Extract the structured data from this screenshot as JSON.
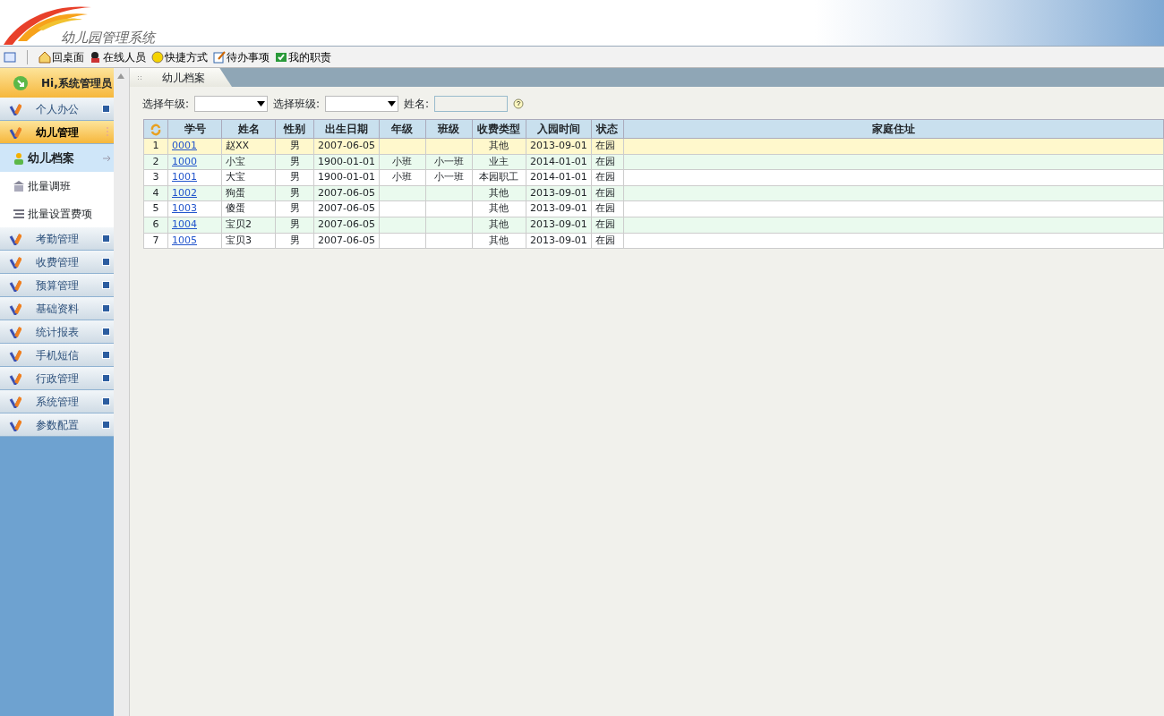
{
  "app": {
    "title": "幼儿园管理系统"
  },
  "toolbar": [
    {
      "label": "回桌面",
      "kind": "home"
    },
    {
      "label": "在线人员",
      "kind": "people"
    },
    {
      "label": "快捷方式",
      "kind": "smile"
    },
    {
      "label": "待办事项",
      "kind": "note"
    },
    {
      "label": "我的职责",
      "kind": "check"
    }
  ],
  "sidebar": {
    "user": "Hi,系统管理员",
    "groups": [
      {
        "label": "个人办公",
        "selected": false,
        "expanded": false
      },
      {
        "label": "幼儿管理",
        "selected": true,
        "expanded": true,
        "children": [
          {
            "label": "幼儿档案",
            "selected": true,
            "kind": "person"
          },
          {
            "label": "批量调班",
            "selected": false,
            "kind": "bank"
          },
          {
            "label": "批量设置费项",
            "selected": false,
            "kind": "list"
          }
        ]
      },
      {
        "label": "考勤管理",
        "selected": false,
        "expanded": false
      },
      {
        "label": "收费管理",
        "selected": false,
        "expanded": false
      },
      {
        "label": "预算管理",
        "selected": false,
        "expanded": false
      },
      {
        "label": "基础资料",
        "selected": false,
        "expanded": false
      },
      {
        "label": "统计报表",
        "selected": false,
        "expanded": false
      },
      {
        "label": "手机短信",
        "selected": false,
        "expanded": false
      },
      {
        "label": "行政管理",
        "selected": false,
        "expanded": false
      },
      {
        "label": "系统管理",
        "selected": false,
        "expanded": false
      },
      {
        "label": "参数配置",
        "selected": false,
        "expanded": false
      }
    ]
  },
  "tabs": [
    {
      "label": "幼儿档案",
      "selected": true
    }
  ],
  "filters": [
    {
      "label": "选择年级:",
      "kind": "select"
    },
    {
      "label": "选择班级:",
      "kind": "select"
    },
    {
      "label": "姓名:",
      "kind": "text"
    }
  ],
  "table": {
    "columns": [
      "学号",
      "姓名",
      "性别",
      "出生日期",
      "年级",
      "班级",
      "收费类型",
      "入园时间",
      "状态",
      "家庭住址"
    ],
    "rows": [
      {
        "selected": true,
        "number": "1",
        "cells": [
          "0001",
          "赵XX",
          "男",
          "2007-06-05",
          "",
          "",
          "其他",
          "2013-09-01",
          "在园"
        ]
      },
      {
        "selected": false,
        "number": "2",
        "cells": [
          "1000",
          "小宝",
          "男",
          "1900-01-01",
          "小班",
          "小一班",
          "业主",
          "2014-01-01",
          "在园"
        ]
      },
      {
        "selected": false,
        "number": "3",
        "cells": [
          "1001",
          "大宝",
          "男",
          "1900-01-01",
          "小班",
          "小一班",
          "本园职工",
          "2014-01-01",
          "在园"
        ]
      },
      {
        "selected": false,
        "number": "4",
        "cells": [
          "1002",
          "狗蛋",
          "男",
          "2007-06-05",
          "",
          "",
          "其他",
          "2013-09-01",
          "在园"
        ]
      },
      {
        "selected": false,
        "number": "5",
        "cells": [
          "1003",
          "傻蛋",
          "男",
          "2007-06-05",
          "",
          "",
          "其他",
          "2013-09-01",
          "在园"
        ]
      },
      {
        "selected": false,
        "number": "6",
        "cells": [
          "1004",
          "宝贝2",
          "男",
          "2007-06-05",
          "",
          "",
          "其他",
          "2013-09-01",
          "在园"
        ]
      },
      {
        "selected": false,
        "number": "7",
        "cells": [
          "1005",
          "宝贝3",
          "男",
          "2007-06-05",
          "",
          "",
          "其他",
          "2013-09-01",
          "在园"
        ]
      }
    ]
  }
}
